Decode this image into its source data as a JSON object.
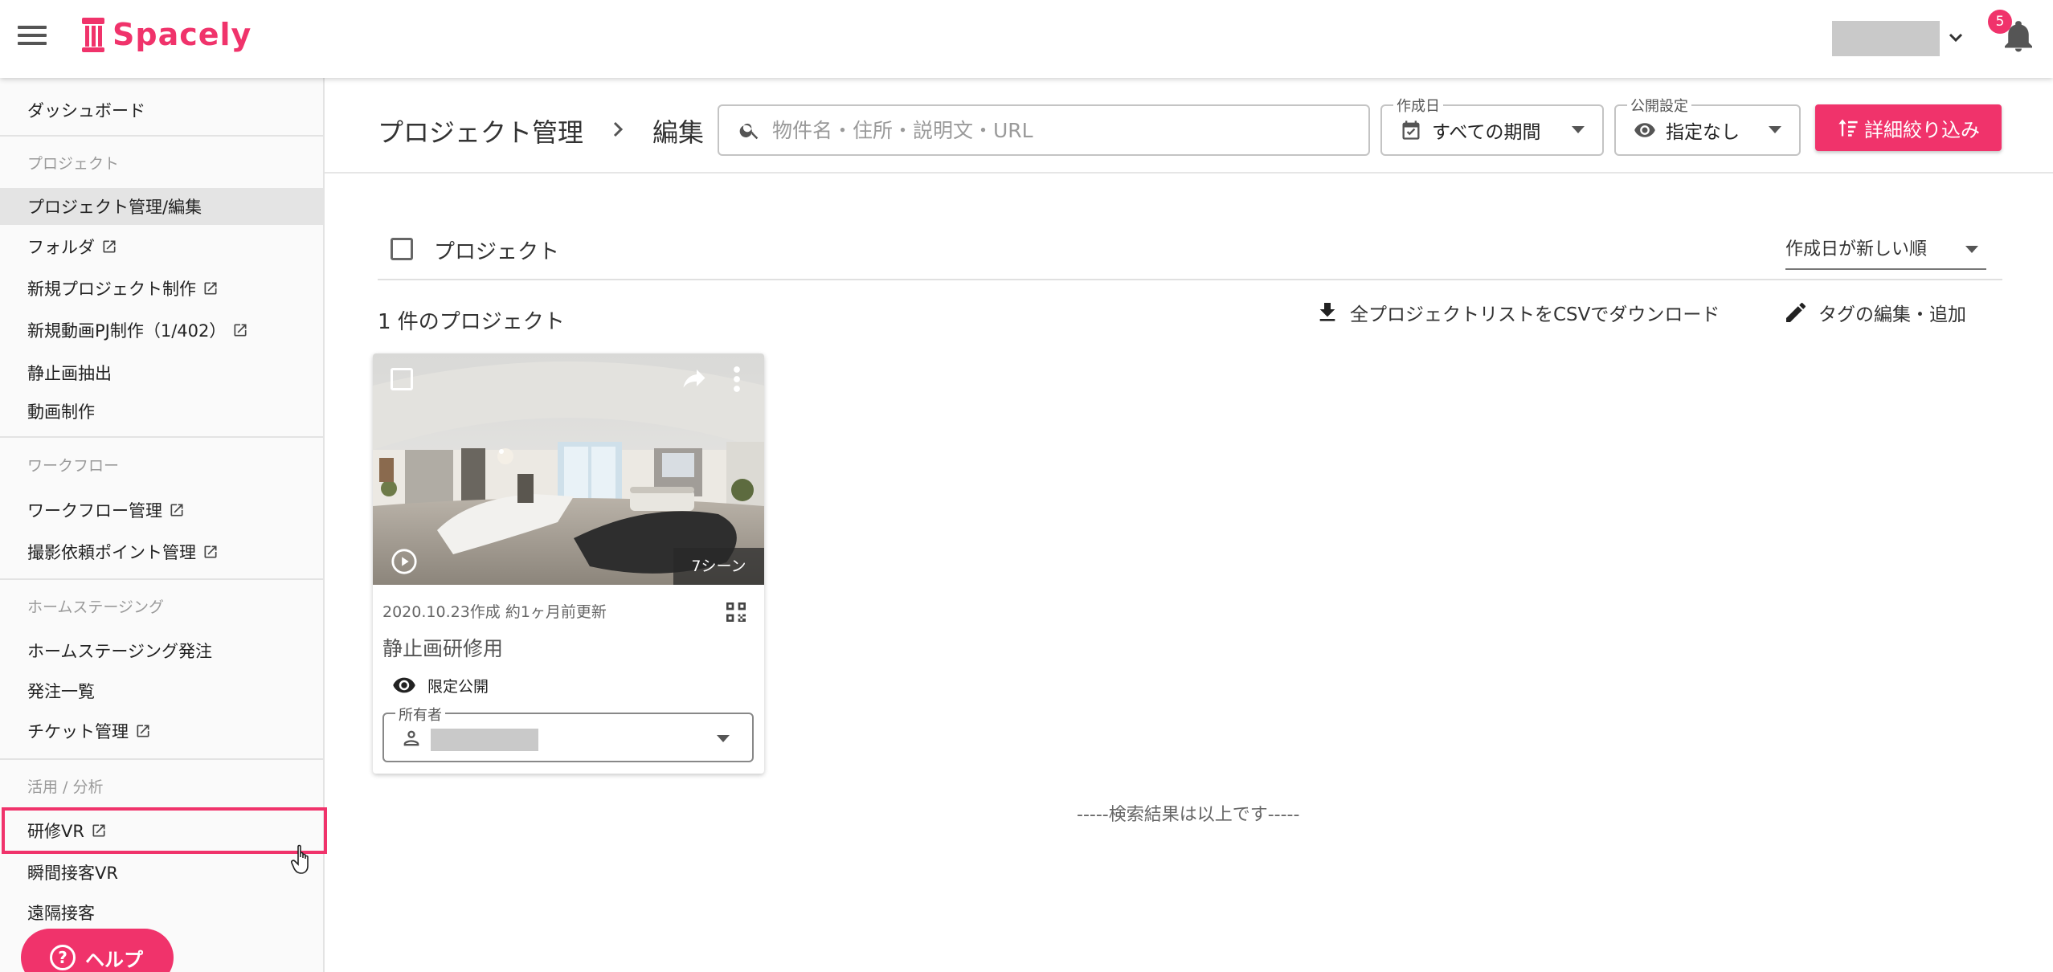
{
  "app": {
    "brand": "Spacely",
    "notification_count": "5",
    "brand_color": "#f0336b"
  },
  "sidebar": {
    "items": [
      {
        "label": "ダッシュボード"
      },
      {
        "label": "プロジェクト管理/編集"
      },
      {
        "label": "フォルダ"
      },
      {
        "label": "新規プロジェクト制作"
      },
      {
        "label": "新規動画PJ制作（1/402）"
      },
      {
        "label": "静止画抽出"
      },
      {
        "label": "動画制作"
      },
      {
        "label": "ワークフロー管理"
      },
      {
        "label": "撮影依頼ポイント管理"
      },
      {
        "label": "ホームステージング発注"
      },
      {
        "label": "発注一覧"
      },
      {
        "label": "チケット管理"
      },
      {
        "label": "研修VR"
      },
      {
        "label": "瞬間接客VR"
      },
      {
        "label": "遠隔接客"
      }
    ],
    "sections": {
      "project": "プロジェクト",
      "workflow": "ワークフロー",
      "homestaging": "ホームステージング",
      "analytics": "活用 / 分析"
    },
    "help_label": "ヘルプ"
  },
  "header": {
    "breadcrumb_root": "プロジェクト管理",
    "breadcrumb_current": "編集",
    "search_placeholder": "物件名・住所・説明文・URL",
    "created_label": "作成日",
    "created_value": "すべての期間",
    "visibility_label": "公開設定",
    "visibility_value": "指定なし",
    "filter_button": "詳細絞り込み"
  },
  "content": {
    "select_all_label": "プロジェクト",
    "sort_value": "作成日が新しい順",
    "result_count": "1 件のプロジェクト",
    "csv_download": "全プロジェクトリストをCSVでダウンロード",
    "tag_edit": "タグの編集・追加",
    "end_of_results": "-----検索結果は以上です-----"
  },
  "card": {
    "scene_count": "7シーン",
    "meta": "2020.10.23作成 約1ヶ月前更新",
    "title": "静止画研修用",
    "visibility": "限定公開",
    "owner_label": "所有者"
  }
}
